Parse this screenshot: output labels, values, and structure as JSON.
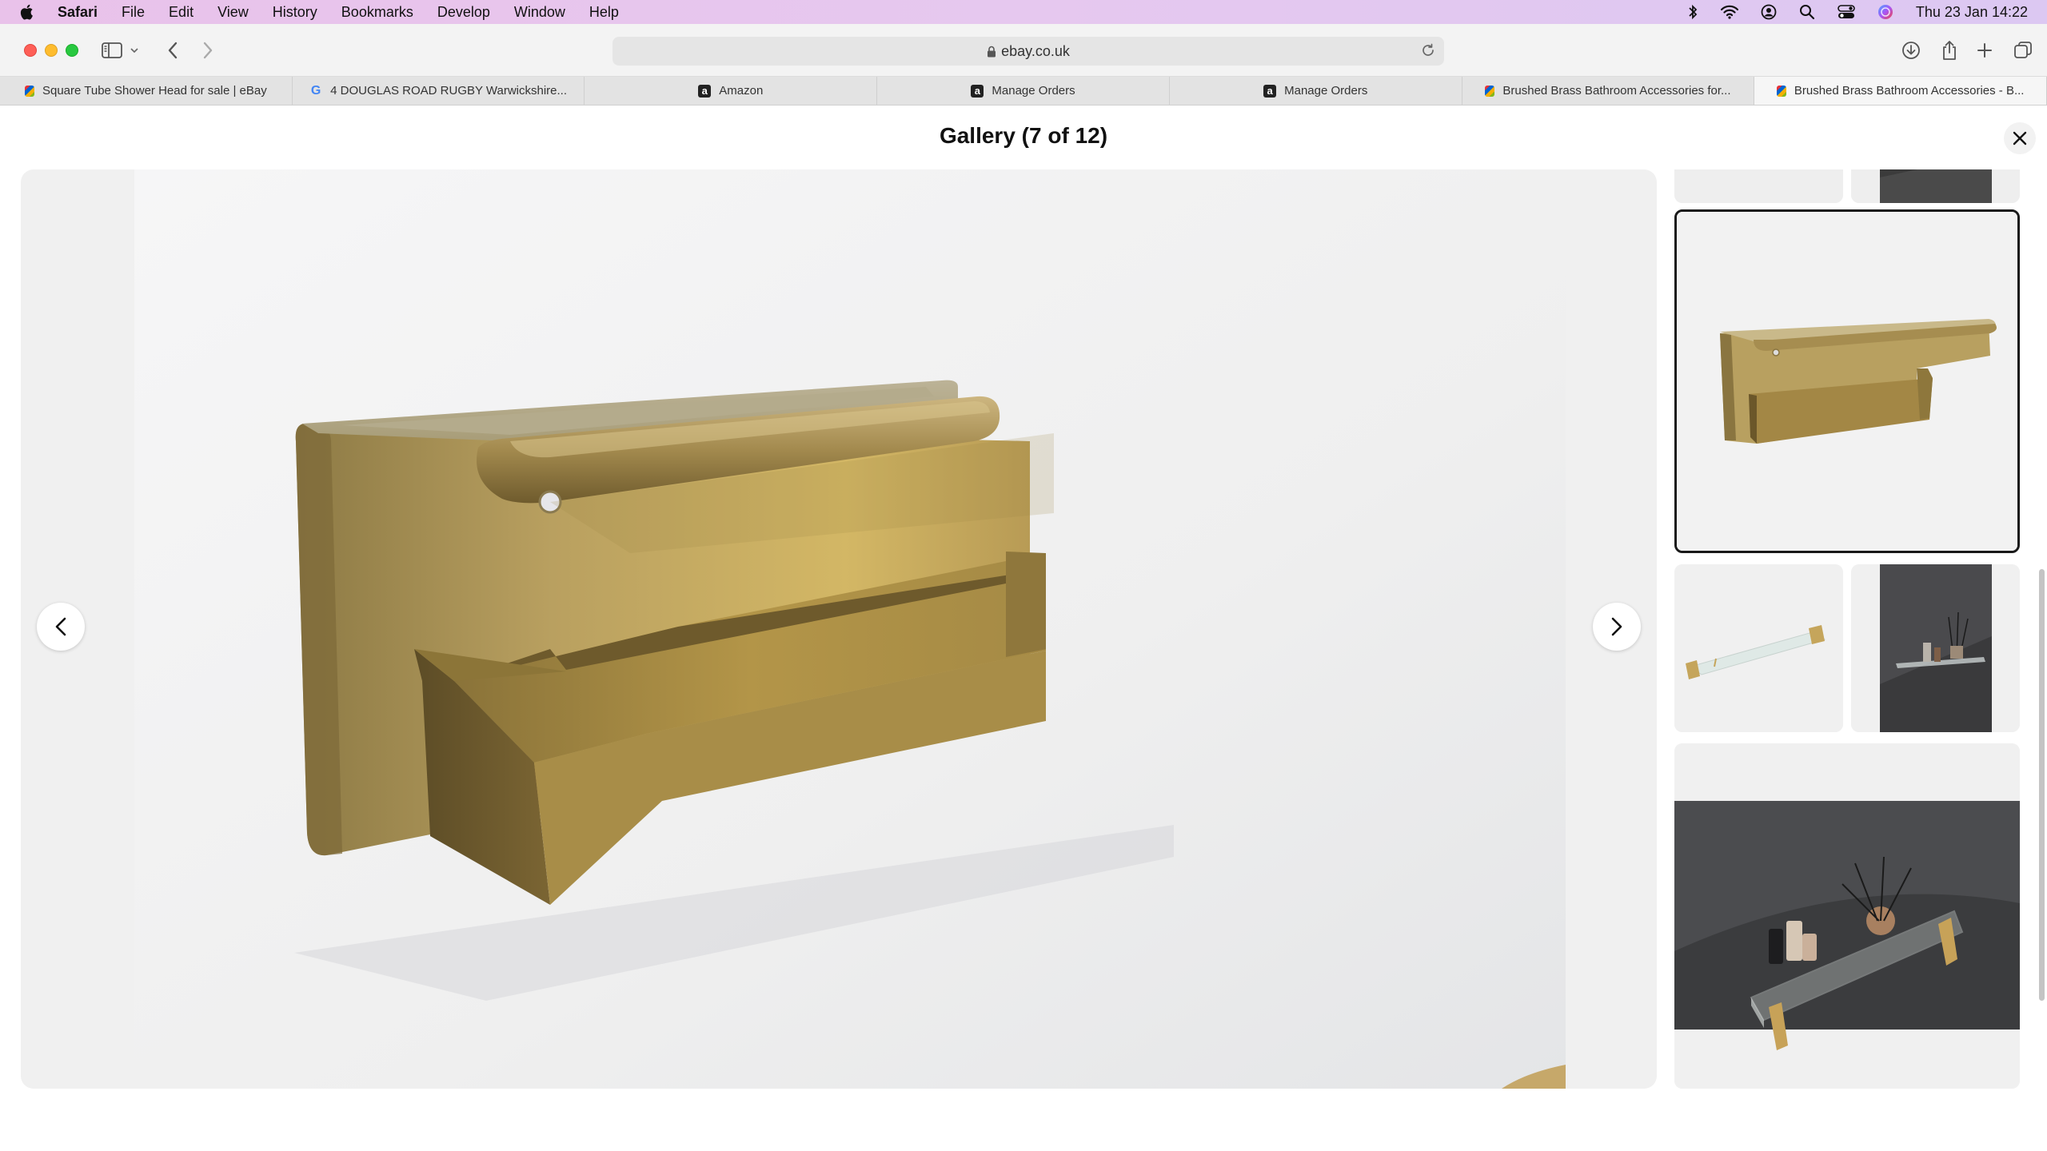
{
  "menubar": {
    "app_name": "Safari",
    "items": [
      "File",
      "Edit",
      "View",
      "History",
      "Bookmarks",
      "Develop",
      "Window",
      "Help"
    ],
    "status_icons": [
      "bluetooth-icon",
      "wifi-icon",
      "user-icon",
      "spotlight-search-icon",
      "control-center-icon",
      "siri-icon"
    ],
    "clock": "Thu 23 Jan  14:22"
  },
  "toolbar": {
    "url": "ebay.co.uk",
    "icons": [
      "sidebar-icon",
      "back-icon",
      "forward-icon",
      "lock-icon",
      "reload-icon",
      "download-icon",
      "share-icon",
      "new-tab-icon",
      "tab-overview-icon"
    ]
  },
  "tabs": [
    {
      "label": "Square Tube Shower Head for sale | eBay",
      "favicon": "ebay"
    },
    {
      "label": "4 DOUGLAS ROAD RUGBY Warwickshire...",
      "favicon": "google"
    },
    {
      "label": "Amazon",
      "favicon": "amazon"
    },
    {
      "label": "Manage Orders",
      "favicon": "amazon"
    },
    {
      "label": "Manage Orders",
      "favicon": "amazon"
    },
    {
      "label": "Brushed Brass Bathroom Accessories for...",
      "favicon": "ebay"
    },
    {
      "label": "Brushed Brass Bathroom Accessories - B...",
      "favicon": "ebay",
      "active": true
    }
  ],
  "gallery": {
    "title": "Gallery (7 of 12)",
    "current_index": 7,
    "total": 12,
    "main_image": "brushed-brass-toilet-roll-holder-with-shelf",
    "thumbnails": [
      {
        "subject": "partial-thumbnail-top-left"
      },
      {
        "subject": "dark-shelf-photo-partial"
      },
      {
        "subject": "brass-toilet-roll-holder-with-shelf",
        "selected": true
      },
      {
        "subject": "glass-shelf-with-brass-brackets"
      },
      {
        "subject": "glass-shelf-on-dark-wall-with-diffuser"
      },
      {
        "subject": "glass-shelf-with-bottles-on-dark-stone"
      }
    ]
  },
  "colors": {
    "brass": "#b59a57",
    "brass_dark": "#8a7139",
    "menubar_accent": "#e6c6ee",
    "selected_border": "#191919"
  }
}
